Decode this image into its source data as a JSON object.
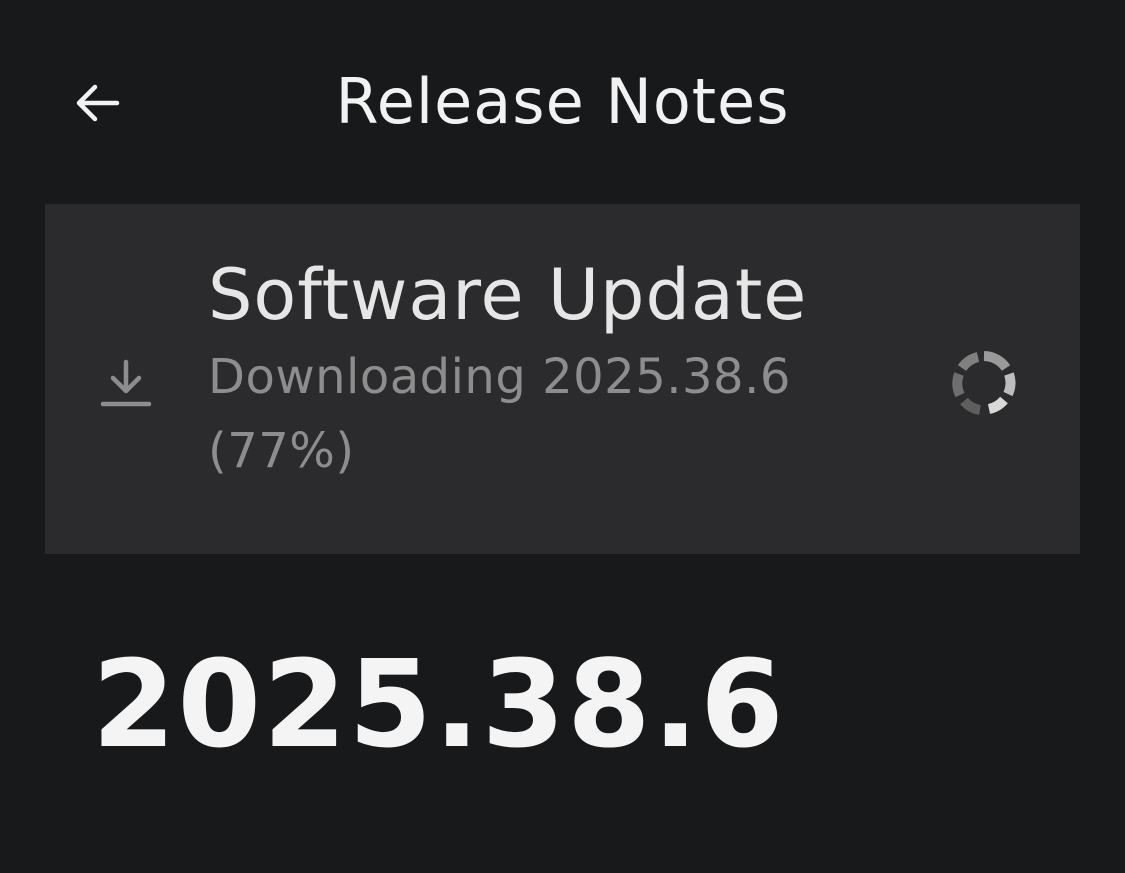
{
  "header": {
    "title": "Release Notes",
    "back_icon": "arrow-left-icon"
  },
  "update_card": {
    "title": "Software Update",
    "status_line1": "Downloading 2025.38.6",
    "status_line2": "(77%)",
    "progress_percent": 77,
    "download_icon": "download-icon",
    "spinner_icon": "loading-spinner-icon"
  },
  "release": {
    "version": "2025.38.6"
  },
  "colors": {
    "background": "#18191b",
    "card": "#2b2b2d",
    "text_primary": "#f2f2f2",
    "text_secondary": "#8d8d8d"
  }
}
